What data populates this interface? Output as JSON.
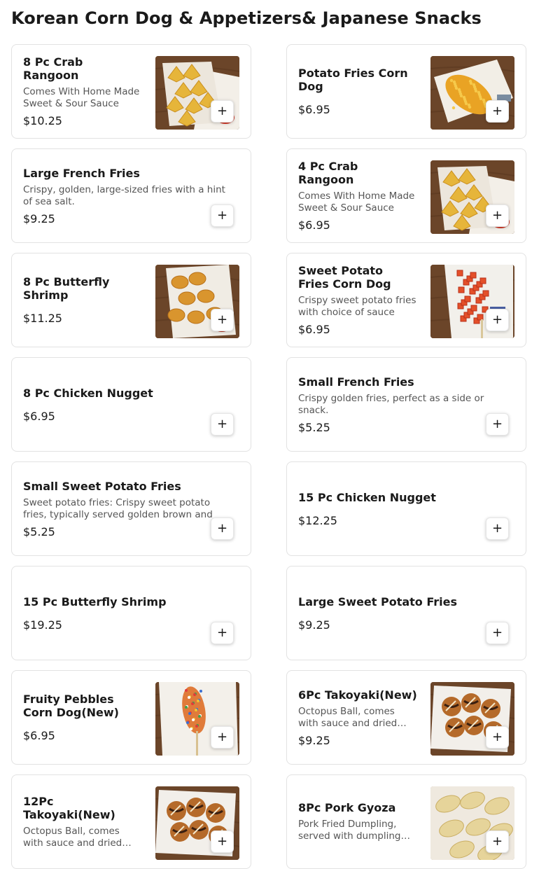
{
  "section": {
    "title": "Korean Corn Dog & Appetizers& Japanese Snacks"
  },
  "add_icon": "plus-icon",
  "add_glyph": "+",
  "items": [
    {
      "name": "8 Pc Crab Rangoon",
      "description": "Comes With Home Made Sweet & Sour Sauce",
      "price": "$10.25",
      "image": "crab-rangoon-photo"
    },
    {
      "name": "Potato Fries Corn Dog",
      "description": "",
      "price": "$6.95",
      "image": "potato-fries-corn-dog-photo"
    },
    {
      "name": "Large French Fries",
      "description": "Crispy, golden, large-sized fries with a hint of sea salt.",
      "price": "$9.25",
      "image": ""
    },
    {
      "name": "4 Pc Crab Rangoon",
      "description": "Comes With Home Made Sweet & Sour Sauce",
      "price": "$6.95",
      "image": "crab-rangoon-photo"
    },
    {
      "name": "8 Pc Butterfly Shrimp",
      "description": "",
      "price": "$11.25",
      "image": "butterfly-shrimp-photo"
    },
    {
      "name": "Sweet Potato Fries Corn Dog",
      "description": "Crispy sweet potato fries with choice of sauce",
      "price": "$6.95",
      "image": "sweet-potato-corn-dog-photo"
    },
    {
      "name": "8 Pc Chicken Nugget",
      "description": "",
      "price": "$6.95",
      "image": ""
    },
    {
      "name": "Small French Fries",
      "description": "Crispy golden fries, perfect as a side or snack.",
      "price": "$5.25",
      "image": ""
    },
    {
      "name": "Small Sweet Potato Fries",
      "description": "Sweet potato fries: Crispy sweet potato fries, typically served golden brown and",
      "price": "$5.25",
      "image": ""
    },
    {
      "name": "15 Pc Chicken Nugget",
      "description": "",
      "price": "$12.25",
      "image": ""
    },
    {
      "name": "15 Pc Butterfly Shrimp",
      "description": "",
      "price": "$19.25",
      "image": ""
    },
    {
      "name": "Large Sweet Potato Fries",
      "description": "",
      "price": "$9.25",
      "image": ""
    },
    {
      "name": "Fruity Pebbles Corn Dog(New)",
      "description": "",
      "price": "$6.95",
      "image": "fruity-pebbles-corn-dog-photo"
    },
    {
      "name": "6Pc Takoyaki(New)",
      "description": "Octopus Ball, comes with sauce and dried bonito flakes",
      "price": "$9.25",
      "image": "takoyaki-photo"
    },
    {
      "name": "12Pc Takoyaki(New)",
      "description": "Octopus Ball, comes with sauce and dried bonito flakes",
      "price": "",
      "image": "takoyaki-photo"
    },
    {
      "name": "8Pc Pork Gyoza",
      "description": "Pork Fried Dumpling, served with dumpling sauce",
      "price": "",
      "image": "gyoza-photo"
    }
  ]
}
